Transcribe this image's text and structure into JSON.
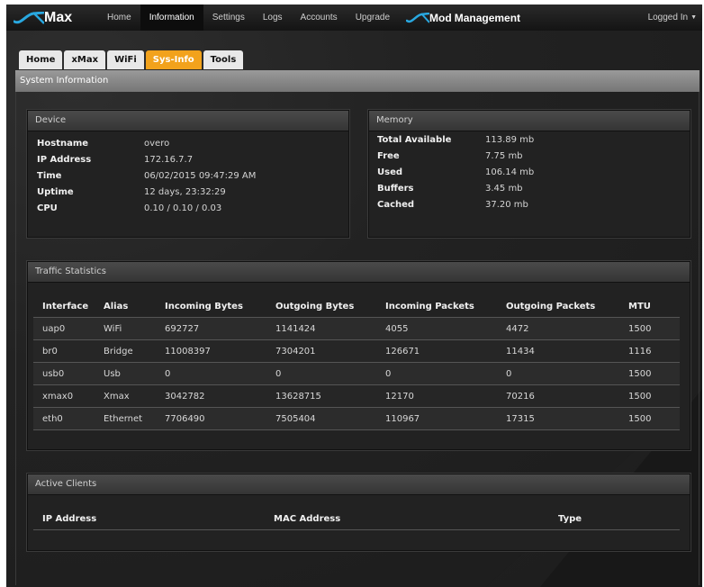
{
  "navbar": {
    "brand": "Max",
    "items": [
      {
        "label": "Home",
        "active": false
      },
      {
        "label": "Information",
        "active": true
      },
      {
        "label": "Settings",
        "active": false
      },
      {
        "label": "Logs",
        "active": false
      },
      {
        "label": "Accounts",
        "active": false
      },
      {
        "label": "Upgrade",
        "active": false
      }
    ],
    "brand2": "Mod",
    "brand2_suffix": "Management",
    "logged_in": "Logged In"
  },
  "tabs": [
    {
      "label": "Home",
      "active": false
    },
    {
      "label": "xMax",
      "active": false
    },
    {
      "label": "WiFi",
      "active": false
    },
    {
      "label": "Sys-Info",
      "active": true
    },
    {
      "label": "Tools",
      "active": false
    }
  ],
  "section_title": "System Information",
  "device": {
    "title": "Device",
    "rows": [
      {
        "label": "Hostname",
        "value": "overo"
      },
      {
        "label": "IP Address",
        "value": "172.16.7.7"
      },
      {
        "label": "Time",
        "value": "06/02/2015 09:47:29 AM"
      },
      {
        "label": "Uptime",
        "value": "12 days, 23:32:29"
      },
      {
        "label": "CPU",
        "value": "0.10 / 0.10 / 0.03"
      }
    ]
  },
  "memory": {
    "title": "Memory",
    "rows": [
      {
        "label": "Total Available",
        "value": "113.89 mb"
      },
      {
        "label": "Free",
        "value": "7.75 mb"
      },
      {
        "label": "Used",
        "value": "106.14 mb"
      },
      {
        "label": "Buffers",
        "value": "3.45 mb"
      },
      {
        "label": "Cached",
        "value": "37.20 mb"
      }
    ]
  },
  "traffic": {
    "title": "Traffic Statistics",
    "columns": [
      "Interface",
      "Alias",
      "Incoming Bytes",
      "Outgoing Bytes",
      "Incoming Packets",
      "Outgoing Packets",
      "MTU"
    ],
    "rows": [
      [
        "uap0",
        "WiFi",
        "692727",
        "1141424",
        "4055",
        "4472",
        "1500"
      ],
      [
        "br0",
        "Bridge",
        "11008397",
        "7304201",
        "126671",
        "11434",
        "1116"
      ],
      [
        "usb0",
        "Usb",
        "0",
        "0",
        "0",
        "0",
        "1500"
      ],
      [
        "xmax0",
        "Xmax",
        "3042782",
        "13628715",
        "12170",
        "70216",
        "1500"
      ],
      [
        "eth0",
        "Ethernet",
        "7706490",
        "7505404",
        "110967",
        "17315",
        "1500"
      ]
    ]
  },
  "clients": {
    "title": "Active Clients",
    "columns": [
      "IP Address",
      "MAC Address",
      "Type"
    ]
  }
}
